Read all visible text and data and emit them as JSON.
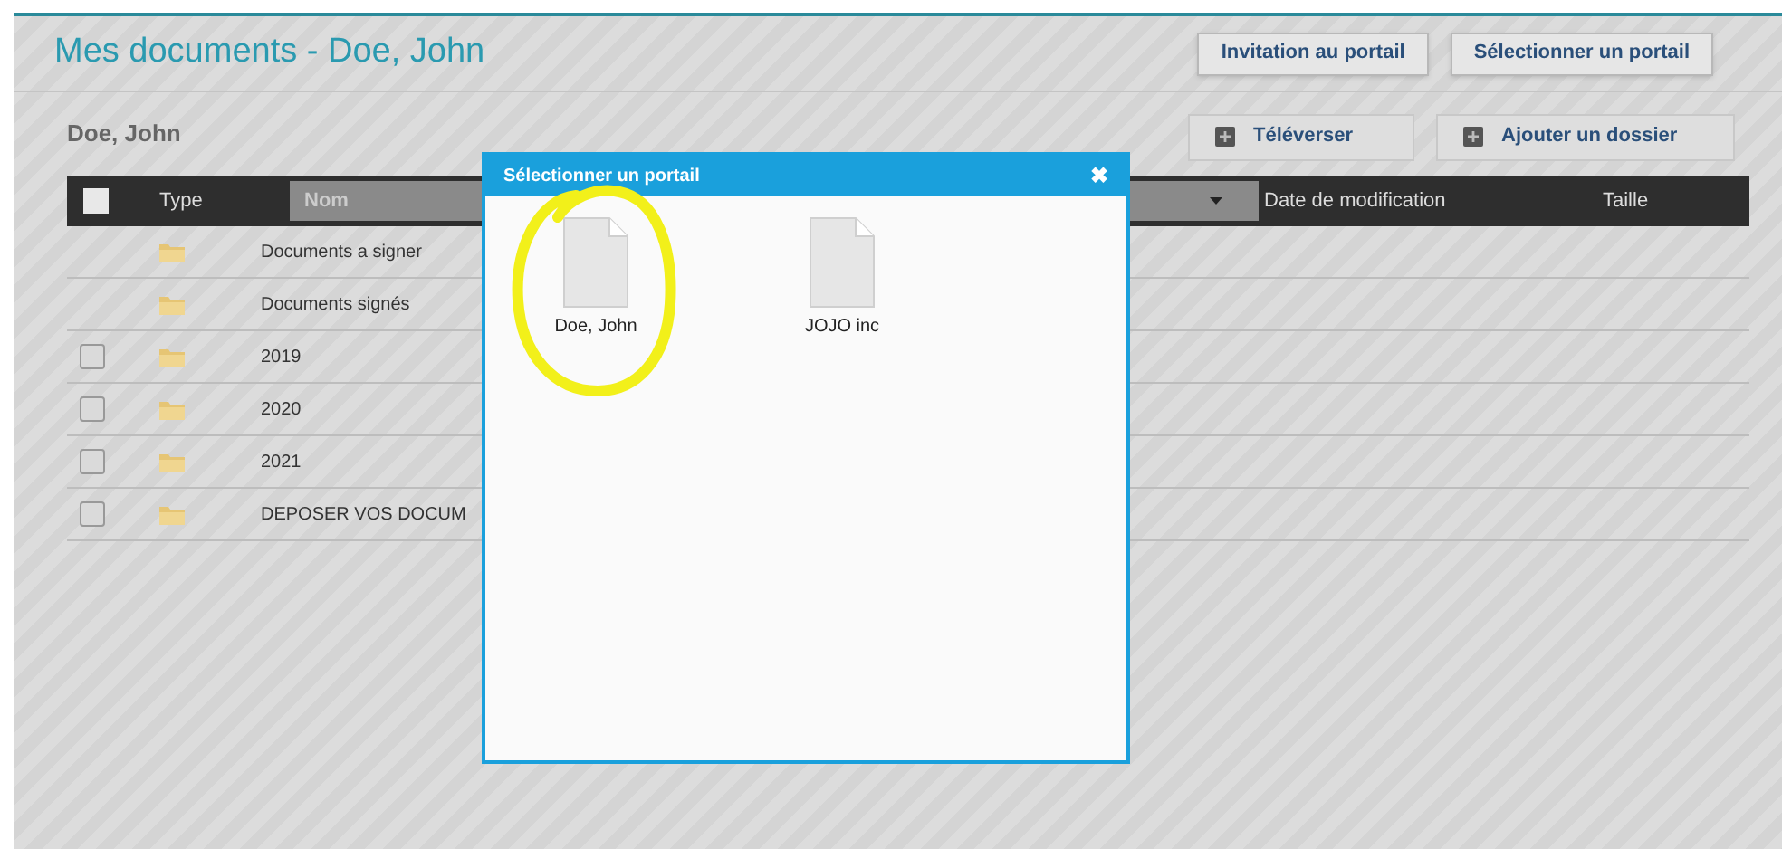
{
  "page": {
    "title": "Mes documents - Doe, John",
    "header_buttons": [
      "Invitation au portail",
      "Sélectionner un portail"
    ]
  },
  "folder": {
    "owner": "Doe, John",
    "actions": [
      "Téléverser",
      "Ajouter un dossier"
    ]
  },
  "table": {
    "select_all_checked": false,
    "columns": [
      "Type",
      "Nom",
      "Date de modification",
      "Taille"
    ],
    "rows": [
      {
        "name": "Documents a signer"
      },
      {
        "name": "Documents signés"
      },
      {
        "name": "2019",
        "checked": false
      },
      {
        "name": "2020",
        "checked": false
      },
      {
        "name": "2021",
        "checked": false
      },
      {
        "name": "DEPOSER VOS DOCUM",
        "checked": false
      }
    ]
  },
  "dialog": {
    "title": "Sélectionner un portail",
    "close": "✖",
    "items": [
      {
        "label": "Doe, John",
        "highlighted": true
      },
      {
        "label": "JOJO inc",
        "highlighted": false
      }
    ]
  }
}
